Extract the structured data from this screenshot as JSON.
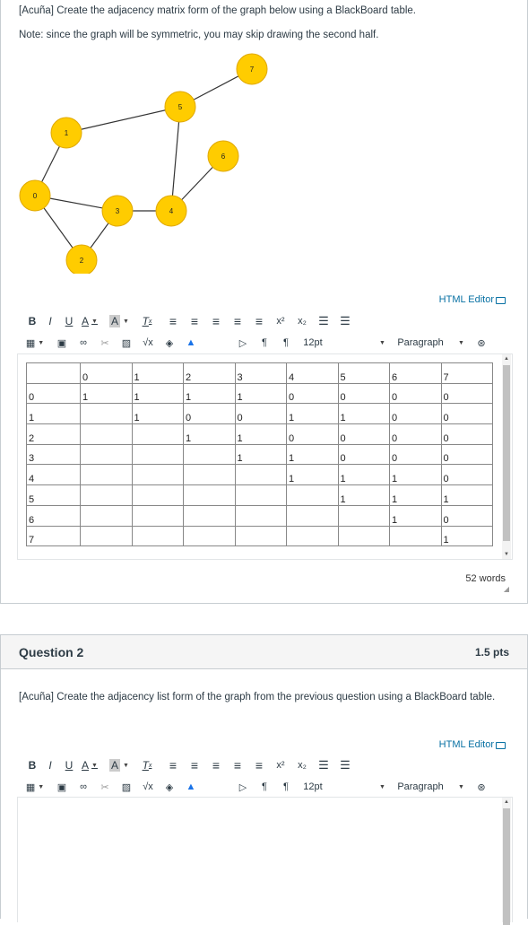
{
  "question1": {
    "line1": "[Acuña] Create the adjacency matrix form of the graph below using a BlackBoard table.",
    "line2": "Note: since the graph will be symmetric, you may skip drawing the second half.",
    "graph": {
      "nodes": [
        "0",
        "1",
        "2",
        "3",
        "4",
        "5",
        "6",
        "7"
      ],
      "edges": [
        [
          "0",
          "1"
        ],
        [
          "0",
          "3"
        ],
        [
          "0",
          "2"
        ],
        [
          "2",
          "3"
        ],
        [
          "3",
          "4"
        ],
        [
          "1",
          "5"
        ],
        [
          "4",
          "5"
        ],
        [
          "4",
          "6"
        ],
        [
          "5",
          "7"
        ]
      ],
      "node_color": "#ffcc00"
    },
    "editor": {
      "html_editor_link": "HTML Editor",
      "font_size": "12pt",
      "block_format": "Paragraph"
    },
    "table": [
      [
        "",
        "0",
        "1",
        "2",
        "3",
        "4",
        "5",
        "6",
        "7"
      ],
      [
        "0",
        "1",
        "1",
        "1",
        "1",
        "0",
        "0",
        "0",
        "0"
      ],
      [
        "1",
        "",
        "1",
        "0",
        "0",
        "1",
        "1",
        "0",
        "0"
      ],
      [
        "2",
        "",
        "",
        "1",
        "1",
        "0",
        "0",
        "0",
        "0"
      ],
      [
        "3",
        "",
        "",
        "",
        "1",
        "1",
        "0",
        "0",
        "0"
      ],
      [
        "4",
        "",
        "",
        "",
        "",
        "1",
        "1",
        "1",
        "0"
      ],
      [
        "5",
        "",
        "",
        "",
        "",
        "",
        "1",
        "1",
        "1"
      ],
      [
        "6",
        "",
        "",
        "",
        "",
        "",
        "",
        "1",
        "0"
      ],
      [
        "7",
        "",
        "",
        "",
        "",
        "",
        "",
        "",
        "1"
      ]
    ],
    "word_count": "52 words"
  },
  "question2": {
    "title": "Question 2",
    "points": "1.5 pts",
    "text": "[Acuña] Create the adjacency list form of the graph from the previous question using a BlackBoard table.",
    "editor": {
      "html_editor_link": "HTML Editor",
      "font_size": "12pt",
      "block_format": "Paragraph"
    }
  },
  "toolbar": {
    "bold": "B",
    "italic": "I",
    "underline": "U",
    "font_color": "A",
    "bg_color": "A",
    "clear_format": "T",
    "superscript": "x²",
    "subscript": "x₂"
  },
  "colors": {
    "link": "#0770a3",
    "node_fill": "#ffcc00",
    "node_stroke": "#e0a800",
    "border": "#c7cdd1"
  }
}
